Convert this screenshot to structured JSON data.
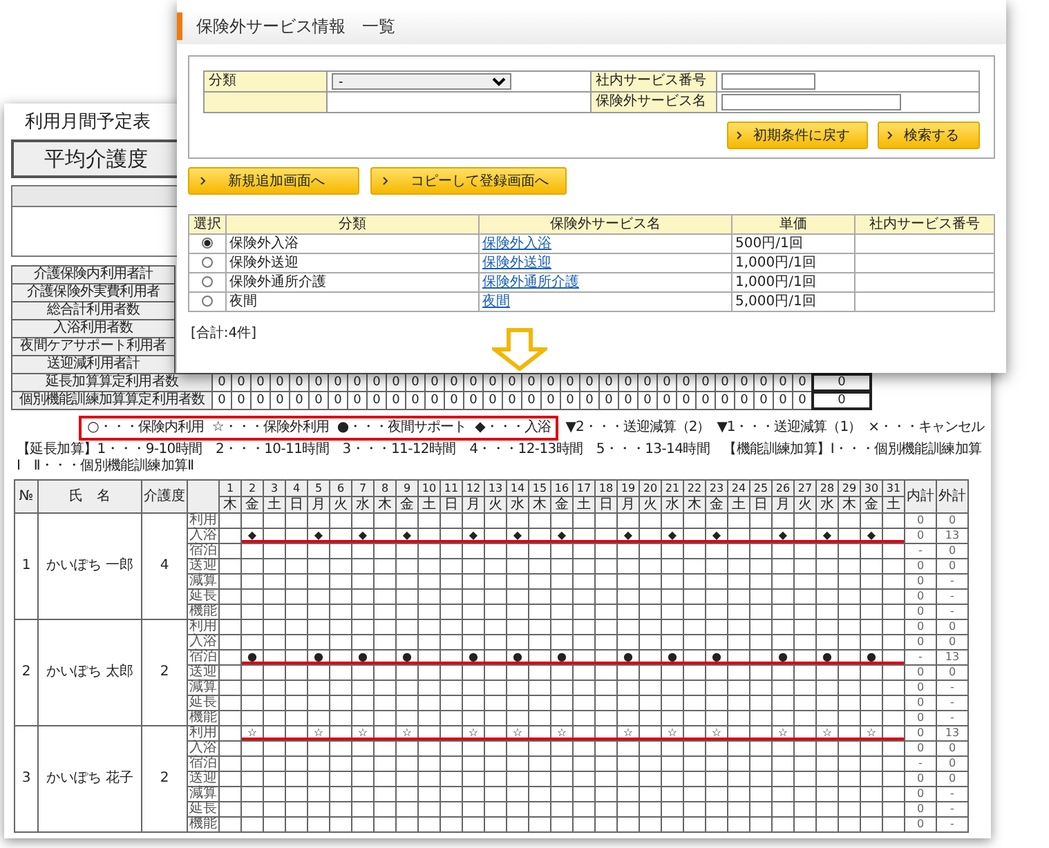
{
  "request_window": {
    "title": "保険外サービス情報　一覧",
    "search_rows": [
      {
        "cells": [
          {
            "kind": "select",
            "label": "分類",
            "value": "-"
          },
          {
            "kind": "text",
            "label": "社内サービス番号"
          }
        ]
      },
      {
        "cells": [
          {
            "kind": "blank"
          },
          {
            "kind": "text_wide",
            "label": "保険外サービス名"
          }
        ]
      }
    ],
    "search_buttons": [
      "初期条件に戻す",
      "検索する"
    ],
    "action_buttons": [
      "新規追加画面へ",
      "コピーして登録画面へ"
    ],
    "columns": [
      "選択",
      "分類",
      "保険外サービス名",
      "単価",
      "社内サービス番号"
    ],
    "rows": [
      {
        "selected": true,
        "category": "保険外入浴",
        "service_name": "保険外入浴",
        "price": "500円/1回"
      },
      {
        "selected": false,
        "category": "保険外送迎",
        "service_name": "保険外送迎",
        "price": "1,000円/1回"
      },
      {
        "selected": false,
        "category": "保険外通所介護",
        "service_name": "保険外通所介護",
        "price": "1,000円/1回"
      },
      {
        "selected": false,
        "category": "夜間",
        "service_name": "夜間",
        "price": "5,000円/1回"
      }
    ],
    "total": "[合計:4件]"
  },
  "schedule": {
    "title": "利用月間予定表",
    "average_label": "平均介護度",
    "summary_rows": [
      {
        "label": "介護保険内利用者計"
      },
      {
        "label": "介護保険外実費利用者"
      },
      {
        "label": "総合計利用者数"
      },
      {
        "label": "入浴利用者数"
      },
      {
        "label": "夜間ケアサポート利用者"
      },
      {
        "label": "送迎減利用者計"
      },
      {
        "label": "延長加算算定利用者数",
        "values": [
          "0",
          "0",
          "0",
          "0",
          "0",
          "0",
          "0",
          "0",
          "0",
          "0",
          "0",
          "0",
          "0",
          "0",
          "0",
          "0",
          "0",
          "0",
          "0",
          "0",
          "0",
          "0",
          "0",
          "0",
          "0",
          "0",
          "0",
          "0",
          "0",
          "0",
          "0"
        ],
        "total": "0"
      },
      {
        "label": "個別機能訓練加算算定利用者数",
        "values": [
          "0",
          "0",
          "0",
          "0",
          "0",
          "0",
          "0",
          "0",
          "0",
          "0",
          "0",
          "0",
          "0",
          "0",
          "0",
          "0",
          "0",
          "0",
          "0",
          "0",
          "0",
          "0",
          "0",
          "0",
          "0",
          "0",
          "0",
          "0",
          "0",
          "0",
          "0"
        ],
        "total": "0"
      }
    ],
    "legend_highlighted": [
      "○・・・保険内利用",
      "☆・・・保険外利用",
      "●・・・夜間サポート",
      "◆・・・入浴"
    ],
    "legend_other": [
      "▼2・・・送迎減算（2）",
      "▼1・・・送迎減算（1）",
      "×・・・キャンセル"
    ],
    "legend_note": "【延長加算】1・・・9-10時間　2・・・10-11時間　3・・・11-12時間　4・・・12-13時間　5・・・13-14時間　【機能訓練加算】Ⅰ・・・個別機能訓練加算Ⅰ　Ⅱ・・・個別機能訓練加算Ⅱ",
    "columns": {
      "no": "№",
      "name": "氏　名",
      "level": "介護度",
      "inner_total": "内計",
      "outer_total": "外計"
    },
    "days": [
      {
        "day": "1",
        "weekday": "木"
      },
      {
        "day": "2",
        "weekday": "金"
      },
      {
        "day": "3",
        "weekday": "土"
      },
      {
        "day": "4",
        "weekday": "日"
      },
      {
        "day": "5",
        "weekday": "月"
      },
      {
        "day": "6",
        "weekday": "火"
      },
      {
        "day": "7",
        "weekday": "水"
      },
      {
        "day": "8",
        "weekday": "木"
      },
      {
        "day": "9",
        "weekday": "金"
      },
      {
        "day": "10",
        "weekday": "土"
      },
      {
        "day": "11",
        "weekday": "日"
      },
      {
        "day": "12",
        "weekday": "月"
      },
      {
        "day": "13",
        "weekday": "火"
      },
      {
        "day": "14",
        "weekday": "水"
      },
      {
        "day": "15",
        "weekday": "木"
      },
      {
        "day": "16",
        "weekday": "金"
      },
      {
        "day": "17",
        "weekday": "土"
      },
      {
        "day": "18",
        "weekday": "日"
      },
      {
        "day": "19",
        "weekday": "月"
      },
      {
        "day": "20",
        "weekday": "火"
      },
      {
        "day": "21",
        "weekday": "水"
      },
      {
        "day": "22",
        "weekday": "木"
      },
      {
        "day": "23",
        "weekday": "金"
      },
      {
        "day": "24",
        "weekday": "土"
      },
      {
        "day": "25",
        "weekday": "日"
      },
      {
        "day": "26",
        "weekday": "月"
      },
      {
        "day": "27",
        "weekday": "火"
      },
      {
        "day": "28",
        "weekday": "水"
      },
      {
        "day": "29",
        "weekday": "木"
      },
      {
        "day": "30",
        "weekday": "金"
      },
      {
        "day": "31",
        "weekday": "土"
      }
    ],
    "persons": [
      {
        "no": "1",
        "name": "かいぽち 一郎",
        "level": "4",
        "rows": [
          {
            "label": "利用",
            "inner": "0",
            "outer": "0",
            "underlined": false
          },
          {
            "label": "入浴",
            "inner": "0",
            "outer": "13",
            "underlined": true,
            "cells": [
              null,
              "◆",
              null,
              null,
              "◆",
              null,
              "◆",
              null,
              "◆",
              null,
              null,
              "◆",
              null,
              "◆",
              null,
              "◆",
              null,
              null,
              "◆",
              null,
              "◆",
              null,
              "◆",
              null,
              null,
              "◆",
              null,
              "◆",
              null,
              "◆",
              null
            ]
          },
          {
            "label": "宿泊",
            "inner": "-",
            "outer": "0",
            "underlined": false
          },
          {
            "label": "送迎",
            "inner": "0",
            "outer": "0",
            "underlined": false
          },
          {
            "label": "減算",
            "inner": "0",
            "outer": "-",
            "underlined": false
          },
          {
            "label": "延長",
            "inner": "0",
            "outer": "-",
            "underlined": false
          },
          {
            "label": "機能",
            "inner": "0",
            "outer": "-",
            "underlined": false
          }
        ]
      },
      {
        "no": "2",
        "name": "かいぽち 太郎",
        "level": "2",
        "rows": [
          {
            "label": "利用",
            "inner": "0",
            "outer": "0",
            "underlined": false
          },
          {
            "label": "入浴",
            "inner": "0",
            "outer": "0",
            "underlined": false
          },
          {
            "label": "宿泊",
            "inner": "-",
            "outer": "13",
            "underlined": true,
            "cells": [
              null,
              "●",
              null,
              null,
              "●",
              null,
              "●",
              null,
              "●",
              null,
              null,
              "●",
              null,
              "●",
              null,
              "●",
              null,
              null,
              "●",
              null,
              "●",
              null,
              "●",
              null,
              null,
              "●",
              null,
              "●",
              null,
              "●",
              null
            ]
          },
          {
            "label": "送迎",
            "inner": "0",
            "outer": "0",
            "underlined": false
          },
          {
            "label": "減算",
            "inner": "0",
            "outer": "-",
            "underlined": false
          },
          {
            "label": "延長",
            "inner": "0",
            "outer": "-",
            "underlined": false
          },
          {
            "label": "機能",
            "inner": "0",
            "outer": "-",
            "underlined": false
          }
        ]
      },
      {
        "no": "3",
        "name": "かいぽち 花子",
        "level": "2",
        "rows": [
          {
            "label": "利用",
            "inner": "0",
            "outer": "13",
            "underlined": true,
            "cells": [
              null,
              "☆",
              null,
              null,
              "☆",
              null,
              "☆",
              null,
              "☆",
              null,
              null,
              "☆",
              null,
              "☆",
              null,
              "☆",
              null,
              null,
              "☆",
              null,
              "☆",
              null,
              "☆",
              null,
              null,
              "☆",
              null,
              "☆",
              null,
              "☆",
              null
            ]
          },
          {
            "label": "入浴",
            "inner": "0",
            "outer": "0",
            "underlined": false
          },
          {
            "label": "宿泊",
            "inner": "-",
            "outer": "0",
            "underlined": false
          },
          {
            "label": "送迎",
            "inner": "0",
            "outer": "0",
            "underlined": false
          },
          {
            "label": "減算",
            "inner": "0",
            "outer": "-",
            "underlined": false
          },
          {
            "label": "延長",
            "inner": "0",
            "outer": "-",
            "underlined": false
          },
          {
            "label": "機能",
            "inner": "0",
            "outer": "-",
            "underlined": false
          }
        ]
      }
    ]
  }
}
